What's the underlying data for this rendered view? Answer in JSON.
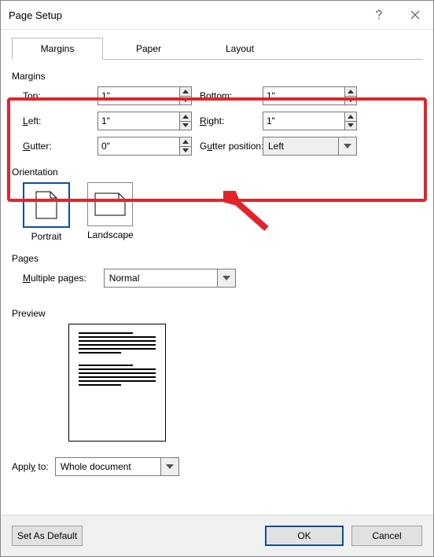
{
  "title": "Page Setup",
  "tabs": [
    {
      "label": "Margins"
    },
    {
      "label": "Paper"
    },
    {
      "label": "Layout"
    }
  ],
  "margins": {
    "section_label": "Margins",
    "top_label": "Top:",
    "top_value": "1\"",
    "bottom_label": "Bottom:",
    "bottom_value": "1\"",
    "left_label": "Left:",
    "left_value": "1\"",
    "right_label": "Right:",
    "right_value": "1\"",
    "gutter_label": "Gutter:",
    "gutter_value": "0\"",
    "gutter_pos_label": "Gutter position:",
    "gutter_pos_value": "Left"
  },
  "orientation": {
    "section_label": "Orientation",
    "portrait": "Portrait",
    "landscape": "Landscape"
  },
  "pages": {
    "section_label": "Pages",
    "multiple_label": "Multiple pages:",
    "multiple_value": "Normal"
  },
  "preview": {
    "section_label": "Preview"
  },
  "apply": {
    "label": "Apply to:",
    "value": "Whole document"
  },
  "footer": {
    "set_default_label": "Set As Default",
    "ok_label": "OK",
    "cancel_label": "Cancel"
  }
}
